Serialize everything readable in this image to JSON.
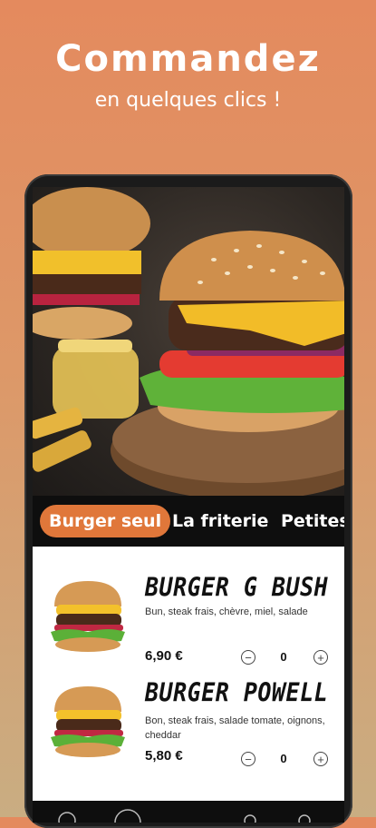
{
  "promo": {
    "headline": "Commandez",
    "subline": "en quelques clics !"
  },
  "tabs": [
    {
      "label": "Burger seul",
      "active": true
    },
    {
      "label": "La friterie",
      "active": false
    },
    {
      "label": "Petites",
      "active": false
    }
  ],
  "products": [
    {
      "name": "BURGER G BUSH",
      "description": "Bun, steak frais, chèvre, miel, salade",
      "price": "6,90 €",
      "quantity": "0",
      "minus": "−",
      "plus": "+"
    },
    {
      "name": "BURGER POWELL",
      "description": "Bon, steak frais, salade tomate, oignons, cheddar",
      "price": "5,80 €",
      "quantity": "0",
      "minus": "−",
      "plus": "+"
    }
  ],
  "colors": {
    "accent": "#e0773a",
    "background_top": "#e48a5e",
    "background_bottom": "#c9ad82",
    "dark": "#0e0e0e"
  }
}
